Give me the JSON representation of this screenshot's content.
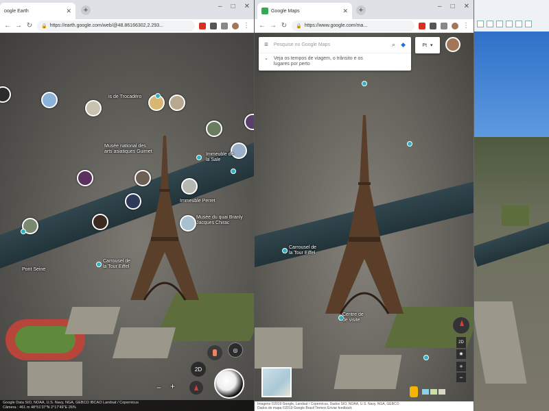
{
  "earth_window": {
    "tab_title": "oogle Earth",
    "url": "https://earth.google.com/web/@48.86166302,2.293...",
    "labels": {
      "trocadero": "is de Trocadéro",
      "museum": "Musée national des\narts asiatiques Guimet",
      "immeuble": "Immeuble de\nla Sale",
      "tour_perret": "Immeuble Perret",
      "quai_branly": "Musée du quai Branly\nJacques Chirac",
      "carrousel": "Carrousel de\nla Tour Eiffel",
      "seine": "Pont Seine"
    },
    "controls": {
      "view_2d": "2D",
      "zoom_out": "−",
      "zoom_in": "+"
    },
    "status_line1": "Google Data SIO, NOAA, U.S. Navy, NGA, GEBCO IBCAO Landsat / Copernicus",
    "status_line2": "Câmera : 461 m  48°51'37\"N 2°17'49\"E  26%"
  },
  "maps_window": {
    "tab_title": "Google Maps",
    "url": "https://www.google.com/ma...",
    "search_placeholder": "Pesquise no Google Maps",
    "hint_text": "Veja os tempos de viagem, o trânsito e os\nlugares por perto",
    "lang_button": "Pt",
    "labels": {
      "carrousel": "Carrousel de\nla Tour Eiffel",
      "centre": "Centre de\nde visite"
    },
    "controls": {
      "view_2d": "2D",
      "zoom_in": "+",
      "zoom_out": "−"
    },
    "footer_line1": "Imagens ©2019 Google, Landsat / Copernicus, Dados SIO, NOAA, U.S. Navy, NGA, GEBCO",
    "footer_line2": "Dados do mapa ©2019 Google   Brasil   Termos   Enviar feedback"
  },
  "colors": {
    "accent_blue": "#1a73e8",
    "pin_teal": "#2bb3c0",
    "track_red": "#b8453a"
  }
}
